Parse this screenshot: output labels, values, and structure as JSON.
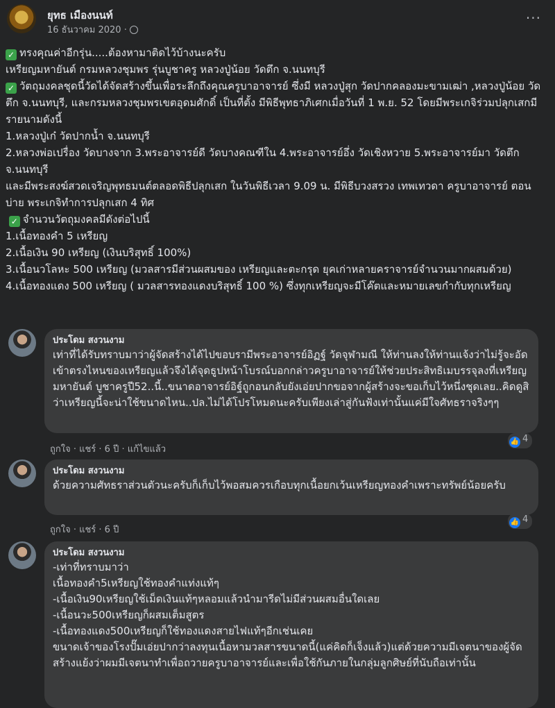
{
  "post": {
    "author": "ยุทธ เมืองนนท์",
    "date": "16 ธันวาคม 2020 ·",
    "lines": [
      "ทรงคุณค่าอีกรุ่น.....ต้องหามาติดไว้บ้างนะครับ",
      "เหรียญมหายันต์ กรมหลวงชุมพร รุ่นบูชาครู หลวงปู่น้อย วัดตึก จ.นนทบุรี",
      "วัตถุมงคลชุดนี้วัดได้จัดสร้างขึ้นเพื่อระลึกถึงคุณครูบาอาจารย์ ซึ่งมี หลวงปู่สุก วัดปากคลองมะขามเฒ่า ,หลวงปู่น้อย วัดตึก จ.นนทบุรี, และกรมหลวงชุมพรเขตอุดมศักดิ์ เป็นที่ตั้ง มีพิธีพุทธาภิเศกเมื่อวันที่ 1 พ.ย. 52 โดยมีพระเกจิร่วมปลุกเสกมีรายนามดังนี้",
      "1.หลวงปู่เก๋ วัดปากน้ำ จ.นนทบุรี",
      "2.หลวงพ่อเปรื่อง วัดบางจาก 3.พระอาจารย์ดี วัดบางคณฑีใน 4.พระอาจารย์อึ่ง วัดเชิงหวาย 5.พระอาจารย์มา วัดตึก จ.นนทบุรี",
      " และมีพระสงฆ์สวดเจริญพุทธมนต์ตลอดพิธีปลุกเสก ในวันพิธีเวลา 9.09 น. มีพิธีบวงสรวง เทพเทวดา ครูบาอาจารย์ ตอนบ่าย พระเกจิทำการปลุกเสก 4 ทิศ",
      "จำนวนวัตถุมงคลมีดังต่อไปนี้",
      "1.เนื้อทองคำ 5 เหรียญ",
      "2.เนื้อเงิน 90 เหรียญ (เงินบริสุทธิ์ 100%)",
      "3.เนื้อนวโลหะ 500 เหรียญ (มวลสารมีส่วนผสมของ เหรียญและตะกรุด ยุคเก่าหลายคราจารย์จำนวนมากผสมด้วย)",
      "4.เนื้อทองแดง 500 เหรียญ ( มวลสารทองแดงบริสุทธิ์ 100 %) ซึ่งทุกเหรียญจะมีโค๊ตและหมายเลขกำกับทุกเหรียญ"
    ]
  },
  "comments": [
    {
      "name": "ประโดม สงวนงาม",
      "text": "เท่าที่ได้รับทราบมาว่าผู้จัดสร้างได้ไปขอบรามีพระอาจารย์อิฏฐ์ วัดจุฬามณี ให้ท่านลงให้ท่านแจ้งว่าไม่รู้จะอัดเข้าตรงไหนของเหรียญแล้วจึงได้จุดธูปหน้าโบรณ์บอกกล่าวครูบาอาจารย์ให้ช่วยประสิทธิเมบรรจุลงที่เหรียญมหายันต์ บูชาครูปี52..นี้..ขนาดอาจารย์อิฐ์ถูกอนกลับยังเอ่ยปากขอจากผู้สร้างจะขอเก็บไว้หนึ่งชุดเลย..คิดดูสิว่าเหรียญนี้จะน่าใช้ขนาดไหน..ปล.ไม่ได้โปรโหมดนะครับเพียงเล่าสู่กันฟังเท่านั้นแค่มีใจศัทธราจริงๆๆ",
      "actions": "ถูกใจ · แชร์ · 6 ปี · แก้ไขแล้ว",
      "reactions": "4"
    },
    {
      "name": "ประโดม สงวนงาม",
      "text": "ด้วยความศัทธราส่วนตัวนะครับก็เก็บไว้พอสมควรเกือบทุกเนื้อยกเว้นเหรียญทองคำเพราะทรัพย์น้อยครับ",
      "actions": "ถูกใจ · แชร์ · 6 ปี",
      "reactions": "4"
    },
    {
      "name": "ประโดม สงวนงาม",
      "lines": [
        "-เท่าที่ทราบมาว่า",
        "เนื้อทองคำ5เหรียญใช้ทองคำแท่งแท้ๆ",
        "-เนื้อเงิน90เหรียญใช้เม็ดเงินแท้ๆหลอมแล้วนำมารีดไม่มีส่วนผสมอื่นใดเลย",
        "-เนื้อนวะ500เหรียญก็ผสมเต็มสูตร",
        "-เนื้อทองแดง500เหรียญก็ใช้ทองแดงสายไฟแท้ๆอีกเช่นเคย",
        "ขนาดเจ้าของโรงปั๊มเอ่ยปากว่าลงทุนเนื้อหามวลสารขนาดนี้(แค่คิดก็เจ็งแล้ว)แต่ด้วยความมีเจตนาของผู้จัดสร้างแย้งว่าผมมีเจตนาทำเพื่อถวายครูบาอาจารย์และเพื่อใช้กันภายในกลุ่มลูกศิษย์ที่นับถือเท่านั้น"
      ]
    }
  ]
}
